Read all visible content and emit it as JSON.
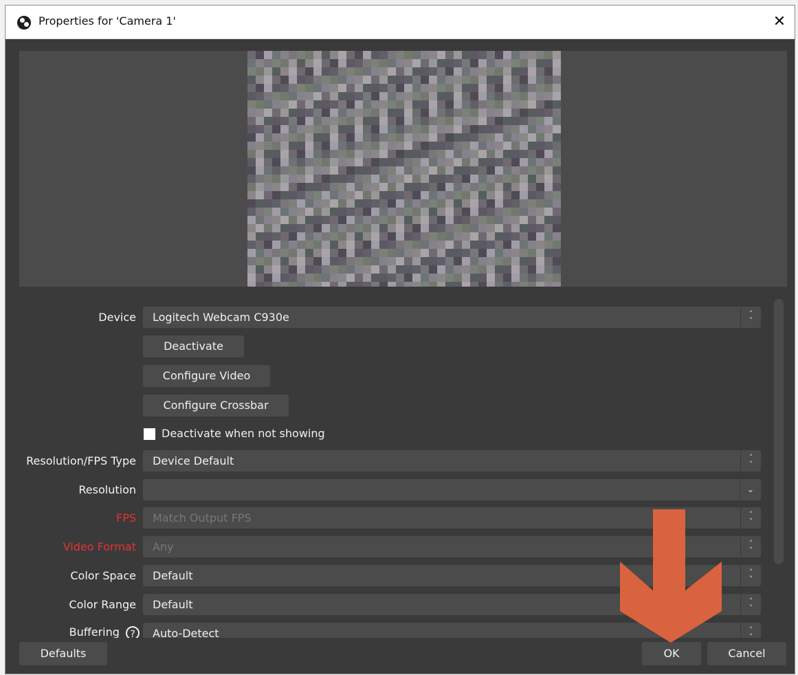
{
  "window": {
    "title": "Properties for 'Camera 1'",
    "close_symbol": "✕"
  },
  "form": {
    "device_label": "Device",
    "device_value": "Logitech Webcam C930e",
    "deactivate_label": "Deactivate",
    "configure_video_label": "Configure Video",
    "configure_crossbar_label": "Configure Crossbar",
    "deactivate_when_not_showing_label": "Deactivate when not showing",
    "resolution_fps_type_label": "Resolution/FPS Type",
    "resolution_fps_type_value": "Device Default",
    "resolution_label": "Resolution",
    "resolution_value": "",
    "fps_label": "FPS",
    "fps_value": "Match Output FPS",
    "video_format_label": "Video Format",
    "video_format_value": "Any",
    "color_space_label": "Color Space",
    "color_space_value": "Default",
    "color_range_label": "Color Range",
    "color_range_value": "Default",
    "buffering_label": "Buffering",
    "buffering_value": "Auto-Detect",
    "help_symbol": "?"
  },
  "footer": {
    "defaults_label": "Defaults",
    "ok_label": "OK",
    "cancel_label": "Cancel"
  },
  "icons": {
    "spin": "spin-arrows-icon",
    "dropdown": "chevron-down-icon",
    "help": "help-icon",
    "close": "close-icon",
    "app": "obs-logo-icon",
    "annotation": "red-down-arrow"
  },
  "colors": {
    "window_bg": "#3a3a3a",
    "control_bg": "#4b4b4b",
    "warning_label": "#e63232",
    "annotation_arrow": "#d9623f"
  }
}
